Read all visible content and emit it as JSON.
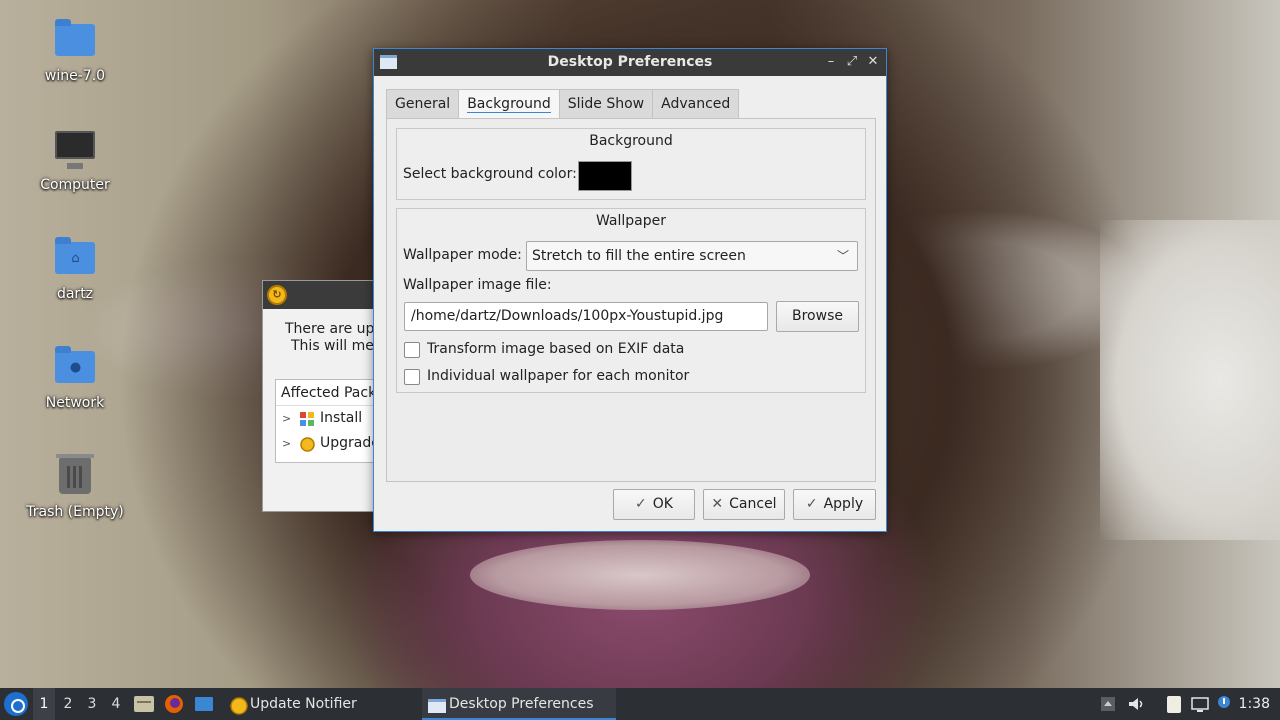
{
  "desktop": {
    "icons": [
      {
        "label": "wine-7.0",
        "icon": "folder-icon"
      },
      {
        "label": "Computer",
        "icon": "computer-icon"
      },
      {
        "label": "dartz",
        "icon": "home-folder-icon"
      },
      {
        "label": "Network",
        "icon": "network-folder-icon"
      },
      {
        "label": "Trash (Empty)",
        "icon": "trash-icon"
      }
    ]
  },
  "update_window": {
    "message_line1": "There are upg",
    "message_line2": "This will mea",
    "tree_header": "Affected Pack",
    "rows": [
      {
        "label": "Install",
        "icon": "package-install-icon"
      },
      {
        "label": "Upgrade",
        "icon": "update-icon"
      }
    ]
  },
  "dialog": {
    "title": "Desktop Preferences",
    "tabs": [
      "General",
      "Background",
      "Slide Show",
      "Advanced"
    ],
    "active_tab": "Background",
    "background_group": {
      "title": "Background",
      "color_label": "Select background color:",
      "color_value": "#000000"
    },
    "wallpaper_group": {
      "title": "Wallpaper",
      "mode_label": "Wallpaper mode:",
      "mode_value": "Stretch to fill the entire screen",
      "file_label": "Wallpaper image file:",
      "file_value": "/home/dartz/Downloads/100px-Youstupid.jpg",
      "browse_label": "Browse",
      "exif_label": "Transform image based on EXIF data",
      "exif_checked": false,
      "per_monitor_label": "Individual wallpaper for each monitor",
      "per_monitor_checked": false
    },
    "buttons": {
      "ok": "OK",
      "cancel": "Cancel",
      "apply": "Apply"
    }
  },
  "taskbar": {
    "workspaces": [
      "1",
      "2",
      "3",
      "4"
    ],
    "active_workspace": "1",
    "tasks": [
      {
        "label": "Update Notifier",
        "icon": "update-icon"
      },
      {
        "label": "Desktop Preferences",
        "icon": "window-icon"
      }
    ],
    "clock": "1:38"
  },
  "colors": {
    "accent": "#3c86d6",
    "titlebar": "#3a3a3a",
    "taskbar": "#2c2f33",
    "folder": "#4a8fe0"
  }
}
